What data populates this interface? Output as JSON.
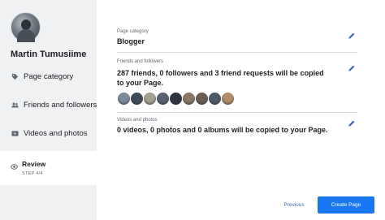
{
  "sidebar": {
    "user_name": "Martin Tumusiime",
    "items": [
      {
        "label": "Page category",
        "icon": "tag-icon"
      },
      {
        "label": "Friends and followers",
        "icon": "people-icon"
      },
      {
        "label": "Videos and photos",
        "icon": "video-icon"
      }
    ],
    "review": {
      "label": "Review",
      "step": "STEP 4/4",
      "icon": "eye-icon"
    }
  },
  "sections": {
    "category": {
      "label": "Page category",
      "value": "Blogger"
    },
    "friends": {
      "label": "Friends and followers",
      "value": "287 friends, 0 followers and 3 friend requests will be copied to your Page."
    },
    "media": {
      "label": "Videos and photos",
      "value": "0 videos, 0 photos and 0 albums will be copied to your Page."
    }
  },
  "friend_avatars": [
    "#7d8a9a",
    "#3f4a58",
    "#a4a08e",
    "#59626e",
    "#2f3540",
    "#8a7766",
    "#6b5f55",
    "#4d5966",
    "#b38c6a"
  ],
  "footer": {
    "previous_label": "Previous",
    "create_label": "Create Page"
  },
  "colors": {
    "accent": "#1877f2",
    "link": "#4267b2",
    "sidebar_bg": "#f0f1f2"
  }
}
